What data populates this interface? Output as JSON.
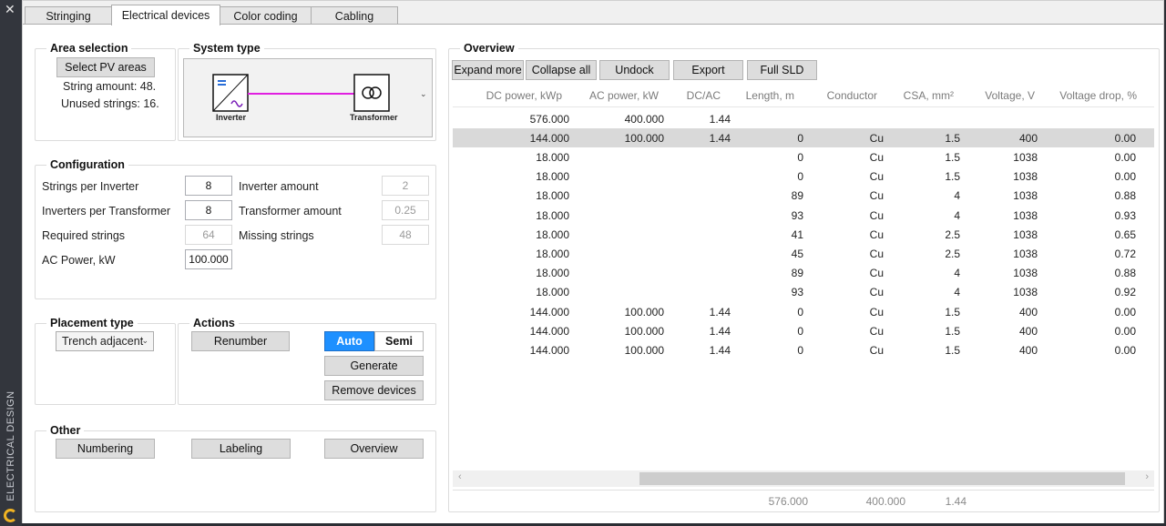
{
  "window": {
    "close_glyph": "✕",
    "side_title": "ELECTRICAL DESIGN"
  },
  "tabs": [
    {
      "label": "Stringing"
    },
    {
      "label": "Electrical devices"
    },
    {
      "label": "Color coding"
    },
    {
      "label": "Cabling"
    }
  ],
  "area_selection": {
    "title": "Area selection",
    "select_button": "Select PV areas",
    "string_amount": "String amount: 48.",
    "unused_strings": "Unused strings: 16."
  },
  "system_type": {
    "title": "System type",
    "inverter_label": "Inverter",
    "transformer_label": "Transformer",
    "line_color": "#e020e0"
  },
  "configuration": {
    "title": "Configuration",
    "strings_per_inverter_label": "Strings per Inverter",
    "strings_per_inverter": "8",
    "inverters_per_transformer_label": "Inverters per Transformer",
    "inverters_per_transformer": "8",
    "required_strings_label": "Required strings",
    "required_strings": "64",
    "ac_power_label": "AC Power, kW",
    "ac_power": "100.000",
    "inverter_amount_label": "Inverter amount",
    "inverter_amount": "2",
    "transformer_amount_label": "Transformer amount",
    "transformer_amount": "0.25",
    "missing_strings_label": "Missing strings",
    "missing_strings": "48"
  },
  "placement": {
    "title": "Placement type",
    "value": "Trench adjacent"
  },
  "actions": {
    "title": "Actions",
    "renumber": "Renumber",
    "auto": "Auto",
    "semi": "Semi",
    "generate": "Generate",
    "remove_devices": "Remove devices",
    "accent": "#1e90ff"
  },
  "other": {
    "title": "Other",
    "numbering": "Numbering",
    "labeling": "Labeling",
    "overview": "Overview"
  },
  "overview": {
    "title": "Overview",
    "toolbar": {
      "expand_more": "Expand more",
      "collapse_all": "Collapse all",
      "undock": "Undock",
      "export": "Export",
      "full_sld": "Full SLD"
    },
    "columns": [
      "DC power, kWp",
      "AC power, kW",
      "DC/AC",
      "Length, m",
      "Conductor",
      "CSA, mm²",
      "Voltage, V",
      "Voltage drop, %"
    ],
    "rows": [
      {
        "selected": false,
        "cells": [
          "576.000",
          "400.000",
          "1.44",
          "",
          "",
          "",
          "",
          ""
        ]
      },
      {
        "selected": true,
        "cells": [
          "144.000",
          "100.000",
          "1.44",
          "0",
          "Cu",
          "1.5",
          "400",
          "0.00"
        ]
      },
      {
        "selected": false,
        "cells": [
          "18.000",
          "",
          "",
          "0",
          "Cu",
          "1.5",
          "1038",
          "0.00"
        ]
      },
      {
        "selected": false,
        "cells": [
          "18.000",
          "",
          "",
          "0",
          "Cu",
          "1.5",
          "1038",
          "0.00"
        ]
      },
      {
        "selected": false,
        "cells": [
          "18.000",
          "",
          "",
          "89",
          "Cu",
          "4",
          "1038",
          "0.88"
        ]
      },
      {
        "selected": false,
        "cells": [
          "18.000",
          "",
          "",
          "93",
          "Cu",
          "4",
          "1038",
          "0.93"
        ]
      },
      {
        "selected": false,
        "cells": [
          "18.000",
          "",
          "",
          "41",
          "Cu",
          "2.5",
          "1038",
          "0.65"
        ]
      },
      {
        "selected": false,
        "cells": [
          "18.000",
          "",
          "",
          "45",
          "Cu",
          "2.5",
          "1038",
          "0.72"
        ]
      },
      {
        "selected": false,
        "cells": [
          "18.000",
          "",
          "",
          "89",
          "Cu",
          "4",
          "1038",
          "0.88"
        ]
      },
      {
        "selected": false,
        "cells": [
          "18.000",
          "",
          "",
          "93",
          "Cu",
          "4",
          "1038",
          "0.92"
        ]
      },
      {
        "selected": false,
        "cells": [
          "144.000",
          "100.000",
          "1.44",
          "0",
          "Cu",
          "1.5",
          "400",
          "0.00"
        ]
      },
      {
        "selected": false,
        "cells": [
          "144.000",
          "100.000",
          "1.44",
          "0",
          "Cu",
          "1.5",
          "400",
          "0.00"
        ]
      },
      {
        "selected": false,
        "cells": [
          "144.000",
          "100.000",
          "1.44",
          "0",
          "Cu",
          "1.5",
          "400",
          "0.00"
        ]
      }
    ],
    "footer": [
      "576.000",
      "400.000",
      "1.44"
    ]
  }
}
